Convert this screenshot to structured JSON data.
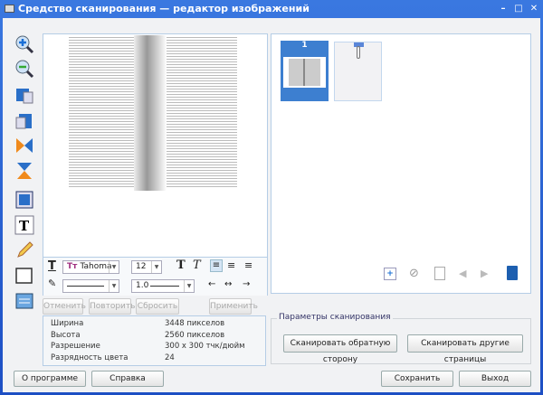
{
  "window": {
    "title": "Средство сканирования — редактор изображений"
  },
  "toolbar": {
    "tools": [
      "zoom-in",
      "zoom-out",
      "crop",
      "rotate",
      "flip-horizontal",
      "flip-vertical",
      "select-area",
      "text",
      "pencil",
      "rectangle",
      "resize"
    ]
  },
  "format": {
    "font": "Tahoma",
    "size": "12",
    "bold": "T",
    "italic": "T",
    "line_width": "1.0"
  },
  "actions": {
    "undo": "Отменить",
    "redo": "Повторить",
    "reset": "Сбросить",
    "apply": "Применить"
  },
  "info": {
    "rows": [
      {
        "label": "Ширина",
        "value": "3448 пикселов"
      },
      {
        "label": "Высота",
        "value": "2560 пикселов"
      },
      {
        "label": "Разрешение",
        "value": "300 x 300 тчк/дюйм"
      },
      {
        "label": "Разрядность цвета",
        "value": "24"
      }
    ]
  },
  "thumbnails": [
    {
      "number": "1",
      "selected": true
    },
    {
      "number": "",
      "selected": false
    }
  ],
  "scan_params": {
    "title": "Параметры сканирования",
    "back_side": "Сканировать обратную сторону",
    "other_pages": "Сканировать другие страницы"
  },
  "footer": {
    "about": "О программе",
    "help": "Справка",
    "save": "Сохранить",
    "exit": "Выход"
  },
  "colors": {
    "titlebar": "#2a62d8",
    "selection": "#3d7fd0",
    "panel_border": "#b5cde6"
  }
}
